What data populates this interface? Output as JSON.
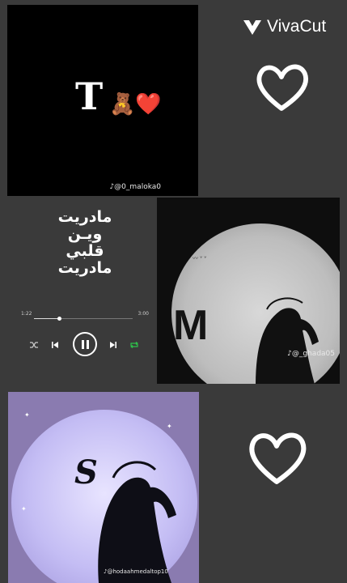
{
  "top_left_image": {
    "letter": "T",
    "emoji": "🧸❤️",
    "watermark": "♪@0_maloka0"
  },
  "brand": {
    "name": "VivaCut",
    "color": "#ffffff"
  },
  "music_player": {
    "lyrics": [
      "مادريت",
      "ويـن",
      "قلبي",
      "مادريت"
    ],
    "time_elapsed": "1:22",
    "time_total": "3:00",
    "progress_fraction": 0.25,
    "icons": [
      "shuffle-icon",
      "previous-icon",
      "pause-icon",
      "next-icon",
      "repeat-icon"
    ]
  },
  "right_middle_image": {
    "letter": "M",
    "watermark": "♪@_ghada05"
  },
  "bottom_left_image": {
    "letter": "S",
    "watermark": "♪@hodaahmedaltop10"
  },
  "colors": {
    "background": "#3a3a3a",
    "repeat_accent": "#2ec24a"
  }
}
